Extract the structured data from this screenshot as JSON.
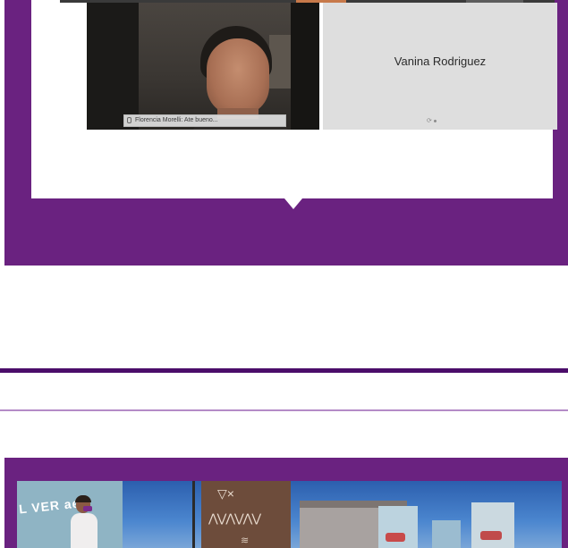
{
  "meeting": {
    "participant_self_tag": "Florencia Morelli: Ate bueno...",
    "participant_name_tile": "Vanina Rodriguez",
    "muted_indicator": "⟳ ⦁"
  },
  "photo": {
    "banner_text": "L VER ae"
  },
  "colors": {
    "card_purple": "#6a2280",
    "rule_dark": "#4b0d6a",
    "rule_light": "#b48bc7"
  }
}
